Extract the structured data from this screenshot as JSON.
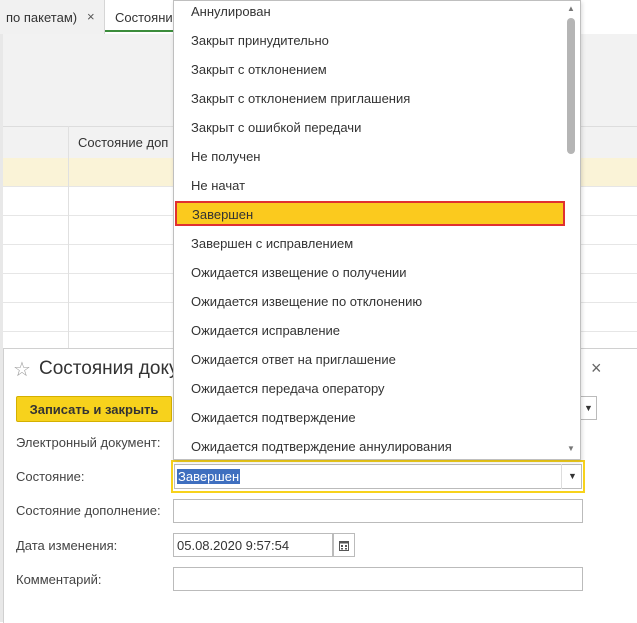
{
  "tabs": {
    "tab1_label": "по пакетам)",
    "tab1_close": "×",
    "tab2_label": "Состояни"
  },
  "grid": {
    "column_header": "Состояние доп"
  },
  "dialog": {
    "title": "Состояния доку",
    "close": "×",
    "save_close_label": "Записать и закрыть",
    "fields": {
      "edoc_label": "Электронный документ:",
      "state_label": "Состояние:",
      "state_value": "Завершен",
      "state_addition_label": "Состояние дополнение:",
      "date_label": "Дата изменения:",
      "date_value": "05.08.2020  9:57:54",
      "comment_label": "Комментарий:"
    }
  },
  "dropdown": {
    "items": [
      "Аннулирован",
      "Закрыт принудительно",
      "Закрыт с отклонением",
      "Закрыт с отклонением приглашения",
      "Закрыт с ошибкой передачи",
      "Не получен",
      "Не начат",
      "Завершен",
      "Завершен с исправлением",
      "Ожидается извещение о получении",
      "Ожидается извещение по отклонению",
      "Ожидается исправление",
      "Ожидается ответ на приглашение",
      "Ожидается передача оператору",
      "Ожидается подтверждение",
      "Ожидается подтверждение аннулирования"
    ],
    "selected": "Завершен"
  },
  "colors": {
    "accent_yellow": "#f7d21c",
    "selected_item": "#fbca1e",
    "selected_border": "#e03030",
    "text_selection": "#3f6fbf",
    "selected_row": "#faf3d7"
  },
  "icons": {
    "star": "star-icon",
    "close": "close-icon",
    "calendar": "calendar-icon",
    "chevron": "chevron-down-icon"
  }
}
